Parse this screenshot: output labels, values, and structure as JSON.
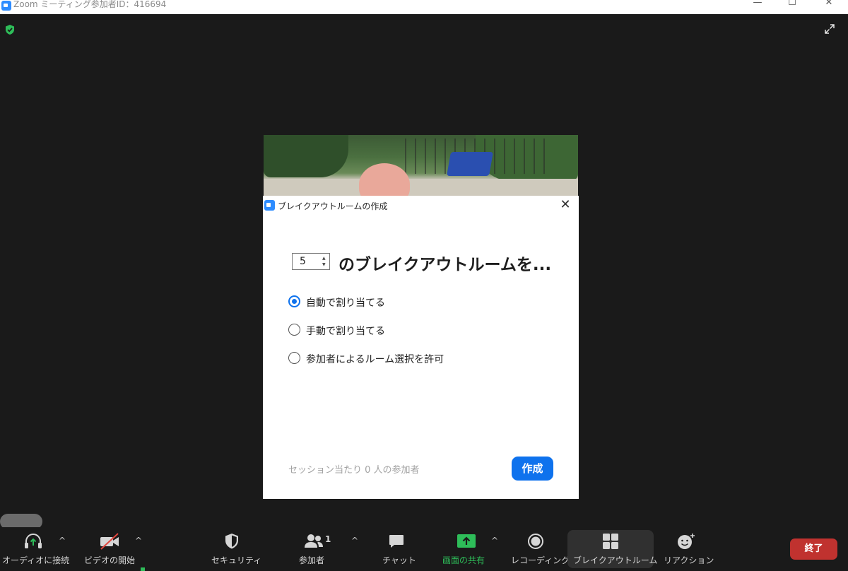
{
  "window": {
    "title": "Zoom ミーティング参加者ID：416694",
    "minimize": "—",
    "maximize": "☐",
    "close": "✕"
  },
  "dialog": {
    "title": "ブレイクアウトルームの作成",
    "close": "✕",
    "room_count": "5",
    "rooms_label": "のブレイクアウトルームを...",
    "options": [
      {
        "label": "自動で割り当てる",
        "selected": true
      },
      {
        "label": "手動で割り当てる",
        "selected": false
      },
      {
        "label": "参加者によるルーム選択を許可",
        "selected": false
      }
    ],
    "footer_note": "セッション当たり 0 人の参加者",
    "create_label": "作成"
  },
  "toolbar": {
    "audio": "オーディオに接続",
    "video": "ビデオの開始",
    "security": "セキュリティ",
    "participants": "参加者",
    "participants_count": "1",
    "chat": "チャット",
    "share": "画面の共有",
    "record": "レコーディング",
    "breakout": "ブレイクアウトルーム",
    "reactions": "リアクション",
    "end": "終了",
    "caret": "^"
  },
  "colors": {
    "accent": "#0e72ed",
    "share_green": "#2ebd59",
    "end_red": "#c0322f",
    "background": "#1a1a1a"
  }
}
